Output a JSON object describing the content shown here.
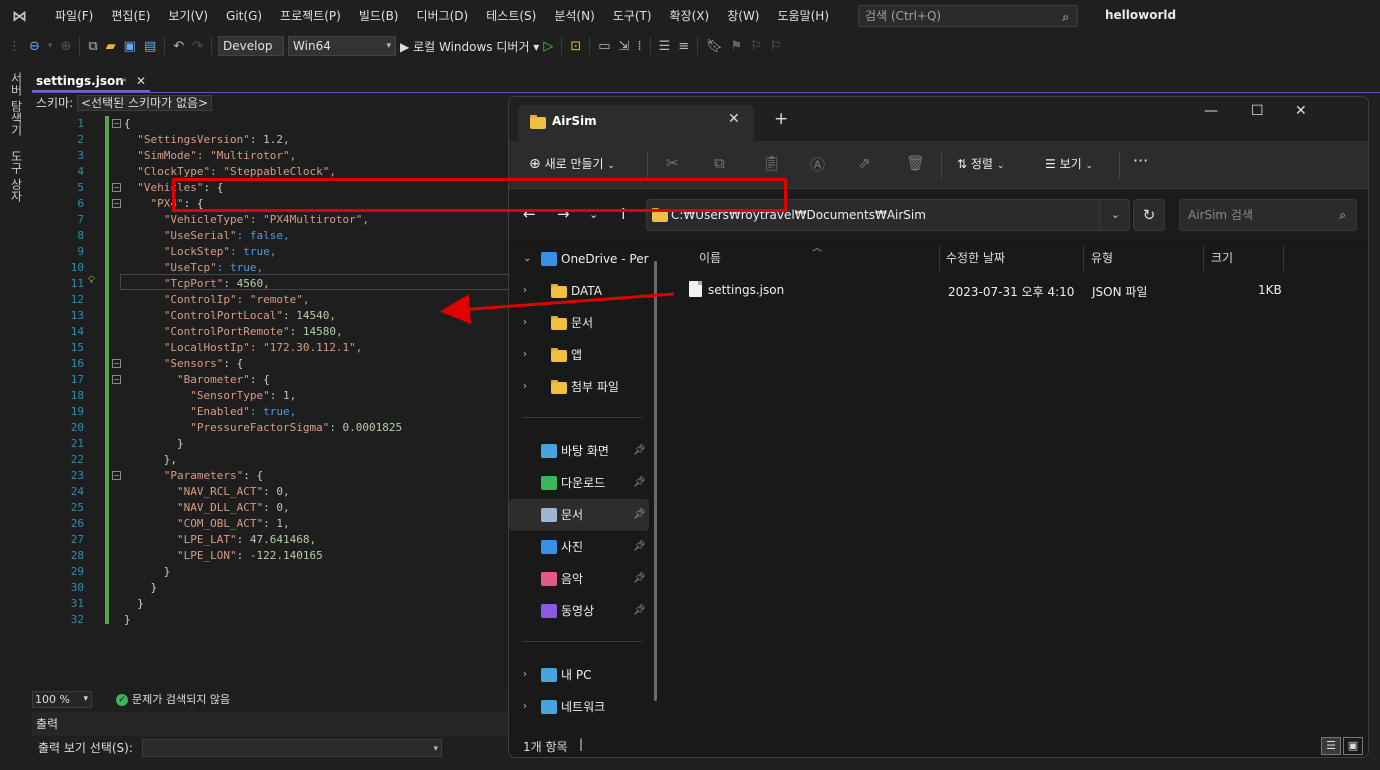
{
  "menubar": {
    "items": [
      "파일(F)",
      "편집(E)",
      "보기(V)",
      "Git(G)",
      "프로젝트(P)",
      "빌드(B)",
      "디버그(D)",
      "테스트(S)",
      "분석(N)",
      "도구(T)",
      "확장(X)",
      "창(W)",
      "도움말(H)"
    ],
    "search_placeholder": "검색 (Ctrl+Q)",
    "solution_name": "helloworld"
  },
  "toolbar": {
    "config": "Develop",
    "platform": "Win64",
    "debugger_label": "▶ 로컬 Windows 디버거 ▾"
  },
  "side_tabs": [
    "서버 탐색기",
    "도구 상자"
  ],
  "editor": {
    "tab_title": "settings.json",
    "schema_label": "스키마:",
    "schema_value": "<선택된 스키마가 없음>",
    "line_numbers": [
      "1",
      "2",
      "3",
      "4",
      "5",
      "6",
      "7",
      "8",
      "9",
      "10",
      "11",
      "12",
      "13",
      "14",
      "15",
      "16",
      "17",
      "18",
      "19",
      "20",
      "21",
      "22",
      "23",
      "24",
      "25",
      "26",
      "27",
      "28",
      "29",
      "30",
      "31",
      "32"
    ],
    "lines": [
      {
        "indent": "",
        "key": "",
        "value": "{",
        "vclass": "p"
      },
      {
        "indent": "  ",
        "key": "\"SettingsVersion\"",
        "value": ": 1.2,",
        "vclass": "n"
      },
      {
        "indent": "  ",
        "key": "\"SimMode\"",
        "value": ": \"Multirotor\",",
        "vclass": "k"
      },
      {
        "indent": "  ",
        "key": "\"ClockType\"",
        "value": ": \"SteppableClock\",",
        "vclass": "k"
      },
      {
        "indent": "  ",
        "key": "\"Vehicles\"",
        "value": ": {",
        "vclass": "p"
      },
      {
        "indent": "    ",
        "key": "\"PX4\"",
        "value": ": {",
        "vclass": "p"
      },
      {
        "indent": "      ",
        "key": "\"VehicleType\"",
        "value": ": \"PX4Multirotor\",",
        "vclass": "k"
      },
      {
        "indent": "      ",
        "key": "\"UseSerial\"",
        "value": ": false,",
        "vclass": "b"
      },
      {
        "indent": "      ",
        "key": "\"LockStep\"",
        "value": ": true,",
        "vclass": "b"
      },
      {
        "indent": "      ",
        "key": "\"UseTcp\"",
        "value": ": true,",
        "vclass": "b"
      },
      {
        "indent": "      ",
        "key": "\"TcpPort\"",
        "value": ": 4560,",
        "vclass": "n"
      },
      {
        "indent": "      ",
        "key": "\"ControlIp\"",
        "value": ": \"remote\",",
        "vclass": "k"
      },
      {
        "indent": "      ",
        "key": "\"ControlPortLocal\"",
        "value": ": 14540,",
        "vclass": "n"
      },
      {
        "indent": "      ",
        "key": "\"ControlPortRemote\"",
        "value": ": 14580,",
        "vclass": "n"
      },
      {
        "indent": "      ",
        "key": "\"LocalHostIp\"",
        "value": ": \"172.30.112.1\",",
        "vclass": "k"
      },
      {
        "indent": "      ",
        "key": "\"Sensors\"",
        "value": ": {",
        "vclass": "p"
      },
      {
        "indent": "        ",
        "key": "\"Barometer\"",
        "value": ": {",
        "vclass": "p"
      },
      {
        "indent": "          ",
        "key": "\"SensorType\"",
        "value": ": 1,",
        "vclass": "n"
      },
      {
        "indent": "          ",
        "key": "\"Enabled\"",
        "value": ": true,",
        "vclass": "b"
      },
      {
        "indent": "          ",
        "key": "\"PressureFactorSigma\"",
        "value": ": 0.0001825",
        "vclass": "n"
      },
      {
        "indent": "        ",
        "key": "",
        "value": "}",
        "vclass": "p"
      },
      {
        "indent": "      ",
        "key": "",
        "value": "},",
        "vclass": "p"
      },
      {
        "indent": "      ",
        "key": "\"Parameters\"",
        "value": ": {",
        "vclass": "p"
      },
      {
        "indent": "        ",
        "key": "\"NAV_RCL_ACT\"",
        "value": ": 0,",
        "vclass": "n"
      },
      {
        "indent": "        ",
        "key": "\"NAV_DLL_ACT\"",
        "value": ": 0,",
        "vclass": "n"
      },
      {
        "indent": "        ",
        "key": "\"COM_OBL_ACT\"",
        "value": ": 1,",
        "vclass": "n"
      },
      {
        "indent": "        ",
        "key": "\"LPE_LAT\"",
        "value": ": 47.641468,",
        "vclass": "n"
      },
      {
        "indent": "        ",
        "key": "\"LPE_LON\"",
        "value": ": -122.140165",
        "vclass": "n"
      },
      {
        "indent": "      ",
        "key": "",
        "value": "}",
        "vclass": "p"
      },
      {
        "indent": "    ",
        "key": "",
        "value": "}",
        "vclass": "p"
      },
      {
        "indent": "  ",
        "key": "",
        "value": "}",
        "vclass": "p"
      },
      {
        "indent": "",
        "key": "",
        "value": "}",
        "vclass": "p"
      }
    ],
    "zoom": "100 %",
    "status": "문제가 검색되지 않음"
  },
  "output": {
    "title": "출력",
    "select_label": "출력 보기 선택(S):"
  },
  "explorer": {
    "tab_title": "AirSim",
    "new_button": "새로 만들기",
    "sort_button": "정렬",
    "view_button": "보기",
    "address": "C:₩Users₩roytravel₩Documents₩AirSim",
    "search_placeholder": "AirSim 검색",
    "nav_items": [
      {
        "label": "OneDrive - Pers",
        "icon": "onedrive-icon",
        "pinned": false,
        "chev": "⌄"
      },
      {
        "label": "DATA",
        "icon": "folder-icon",
        "pinned": false,
        "chev": "›"
      },
      {
        "label": "문서",
        "icon": "folder-icon",
        "pinned": false,
        "chev": "›"
      },
      {
        "label": "앱",
        "icon": "folder-icon",
        "pinned": false,
        "chev": "›"
      },
      {
        "label": "첨부 파일",
        "icon": "folder-icon",
        "pinned": false,
        "chev": "›"
      },
      {
        "label": "바탕 화면",
        "icon": "desktop-icon",
        "pinned": true,
        "chev": ""
      },
      {
        "label": "다운로드",
        "icon": "download-icon",
        "pinned": true,
        "chev": ""
      },
      {
        "label": "문서",
        "icon": "documents-icon",
        "pinned": true,
        "chev": ""
      },
      {
        "label": "사진",
        "icon": "pictures-icon",
        "pinned": true,
        "chev": ""
      },
      {
        "label": "음악",
        "icon": "music-icon",
        "pinned": true,
        "chev": ""
      },
      {
        "label": "동영상",
        "icon": "videos-icon",
        "pinned": true,
        "chev": ""
      },
      {
        "label": "내 PC",
        "icon": "pc-icon",
        "pinned": false,
        "chev": "›"
      },
      {
        "label": "네트워크",
        "icon": "network-icon",
        "pinned": false,
        "chev": "›"
      }
    ],
    "columns": [
      "이름",
      "수정한 날짜",
      "유형",
      "크기"
    ],
    "files": [
      {
        "name": "settings.json",
        "modified": "2023-07-31 오후 4:10",
        "type": "JSON 파일",
        "size": "1KB"
      }
    ],
    "status": "1개 항목",
    "colors": {
      "highlight_box": "#e00000",
      "arrow": "#e00000",
      "folder": "#f0c040"
    }
  }
}
